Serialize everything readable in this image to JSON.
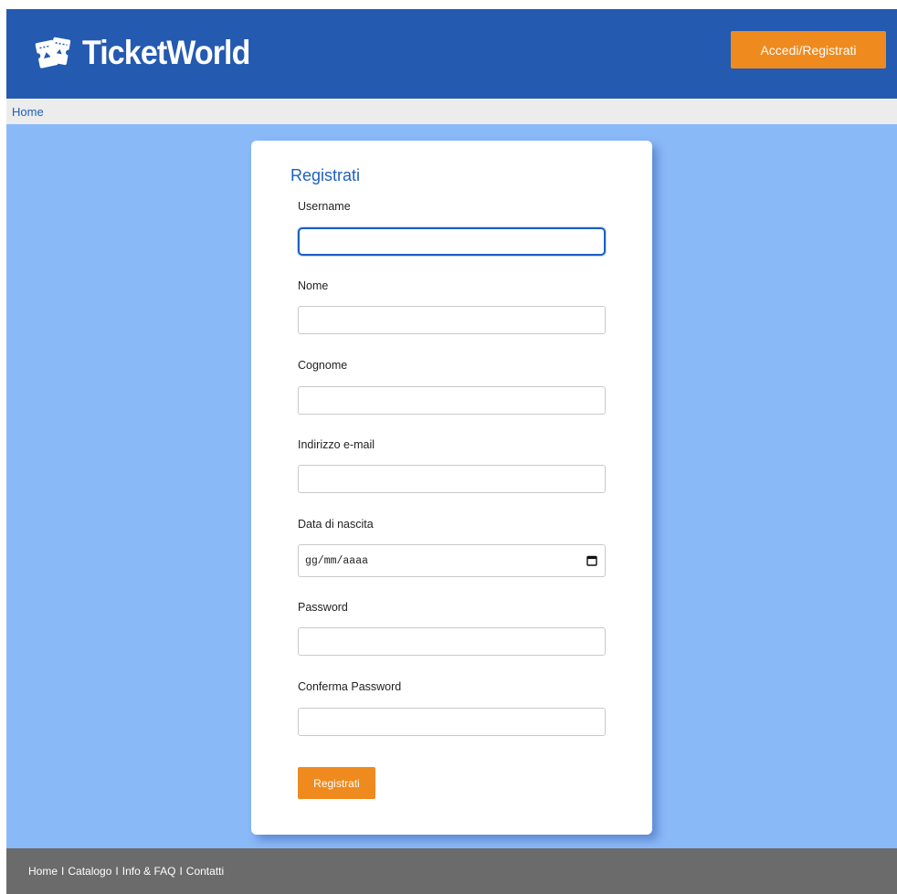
{
  "header": {
    "brand": "TicketWorld",
    "login_button": "Accedi/Registrati",
    "brand_color": "#245ab0",
    "accent_color": "#ef8a1e"
  },
  "breadcrumb": {
    "home": "Home"
  },
  "form": {
    "title": "Registrati",
    "fields": [
      {
        "label": "Username",
        "value": "",
        "focused": true
      },
      {
        "label": "Nome",
        "value": ""
      },
      {
        "label": "Cognome",
        "value": ""
      },
      {
        "label": "Indirizzo e-mail",
        "value": ""
      },
      {
        "label": "Data di nascita",
        "placeholder": "gg/mm/aaaa",
        "icon": "calendar-icon"
      },
      {
        "label": "Password",
        "value": ""
      },
      {
        "label": "Conferma Password",
        "value": ""
      }
    ],
    "submit": "Registrati"
  },
  "footer": {
    "links": [
      "Home",
      "Catalogo",
      "Info & FAQ",
      "Contatti"
    ],
    "separator": "I"
  },
  "page_background": "#8ab9f8"
}
